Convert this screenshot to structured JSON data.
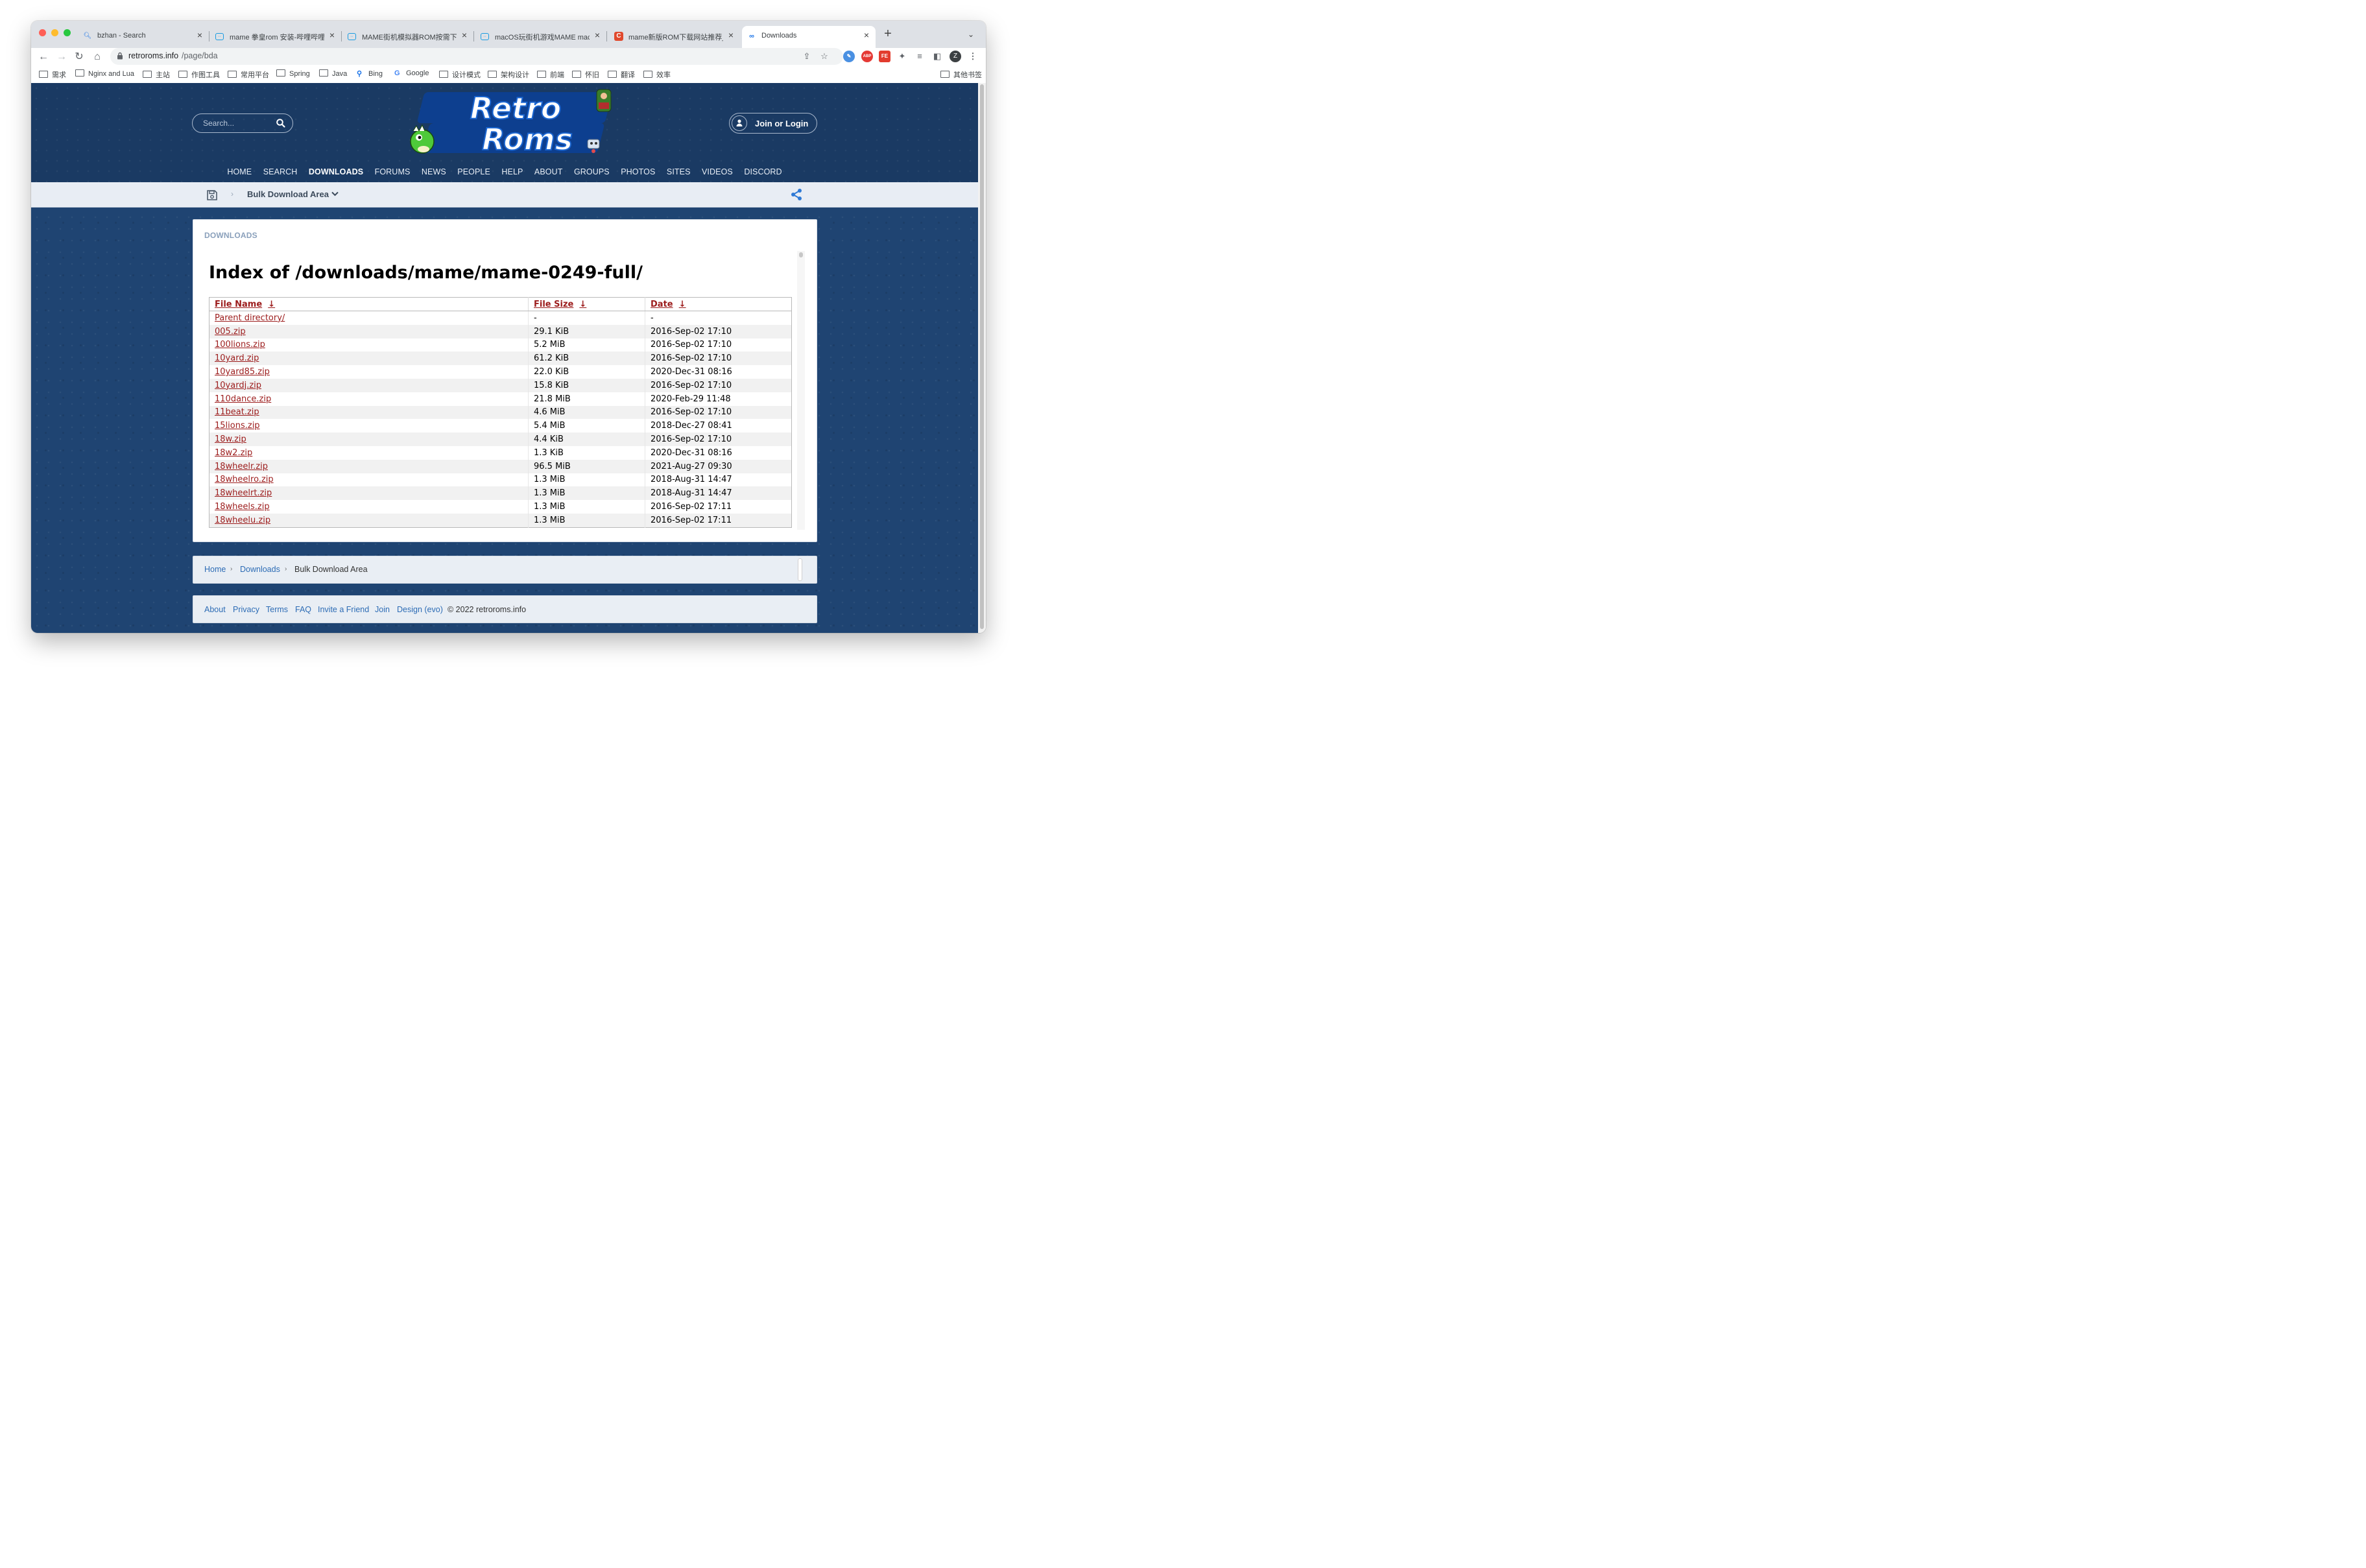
{
  "browser": {
    "tabs": [
      {
        "title": "bzhan - Search",
        "icon": "search-icon"
      },
      {
        "title": "mame 拳皇rom 安装-哔哩哔哩_B",
        "icon": "bilibili-icon"
      },
      {
        "title": "MAME街机模拟器ROM按需下载",
        "icon": "bilibili-icon"
      },
      {
        "title": "macOS玩街机游戏MAME mac版",
        "icon": "bilibili-icon"
      },
      {
        "title": "mame新版ROM下载网站推荐_IT",
        "icon": "csdn-icon"
      },
      {
        "title": "Downloads",
        "icon": "retroroms-icon"
      }
    ],
    "url_host": "retroroms.info",
    "url_path": "/page/bda",
    "profile_initial": "Z",
    "bookmarks": [
      {
        "label": "需求",
        "icon": "folder-icon"
      },
      {
        "label": "Nginx and Lua",
        "icon": "folder-icon"
      },
      {
        "label": "主站",
        "icon": "folder-icon"
      },
      {
        "label": "作图工具",
        "icon": "folder-icon"
      },
      {
        "label": "常用平台",
        "icon": "folder-icon"
      },
      {
        "label": "Spring",
        "icon": "folder-icon"
      },
      {
        "label": "Java",
        "icon": "folder-icon"
      },
      {
        "label": "Bing",
        "icon": "search-icon"
      },
      {
        "label": "Google",
        "icon": "google-icon"
      },
      {
        "label": "设计模式",
        "icon": "folder-icon"
      },
      {
        "label": "架构设计",
        "icon": "folder-icon"
      },
      {
        "label": "前端",
        "icon": "folder-icon"
      },
      {
        "label": "怀旧",
        "icon": "folder-icon"
      },
      {
        "label": "翻译",
        "icon": "folder-icon"
      },
      {
        "label": "效率",
        "icon": "folder-icon"
      }
    ],
    "other_bookmarks": "其他书签"
  },
  "site": {
    "search_placeholder": "Search...",
    "login_label": "Join or Login",
    "logo_line1": "Retro",
    "logo_line2": "Roms",
    "nav": [
      "HOME",
      "SEARCH",
      "DOWNLOADS",
      "FORUMS",
      "NEWS",
      "PEOPLE",
      "HELP",
      "ABOUT",
      "GROUPS",
      "PHOTOS",
      "SITES",
      "VIDEOS",
      "DISCORD"
    ],
    "nav_active": "DOWNLOADS",
    "subbar_title": "Bulk Download Area",
    "panel_label": "DOWNLOADS"
  },
  "listing": {
    "heading": "Index of /downloads/mame/mame-0249-full/",
    "columns": [
      "File Name",
      "File Size",
      "Date"
    ],
    "sort_arrow": "↓",
    "rows": [
      {
        "name": "Parent directory/",
        "size": "-",
        "date": "-"
      },
      {
        "name": "005.zip",
        "size": "29.1 KiB",
        "date": "2016-Sep-02 17:10"
      },
      {
        "name": "100lions.zip",
        "size": "5.2 MiB",
        "date": "2016-Sep-02 17:10"
      },
      {
        "name": "10yard.zip",
        "size": "61.2 KiB",
        "date": "2016-Sep-02 17:10"
      },
      {
        "name": "10yard85.zip",
        "size": "22.0 KiB",
        "date": "2020-Dec-31 08:16"
      },
      {
        "name": "10yardj.zip",
        "size": "15.8 KiB",
        "date": "2016-Sep-02 17:10"
      },
      {
        "name": "110dance.zip",
        "size": "21.8 MiB",
        "date": "2020-Feb-29 11:48"
      },
      {
        "name": "11beat.zip",
        "size": "4.6 MiB",
        "date": "2016-Sep-02 17:10"
      },
      {
        "name": "15lions.zip",
        "size": "5.4 MiB",
        "date": "2018-Dec-27 08:41"
      },
      {
        "name": "18w.zip",
        "size": "4.4 KiB",
        "date": "2016-Sep-02 17:10"
      },
      {
        "name": "18w2.zip",
        "size": "1.3 KiB",
        "date": "2020-Dec-31 08:16"
      },
      {
        "name": "18wheelr.zip",
        "size": "96.5 MiB",
        "date": "2021-Aug-27 09:30"
      },
      {
        "name": "18wheelro.zip",
        "size": "1.3 MiB",
        "date": "2018-Aug-31 14:47"
      },
      {
        "name": "18wheelrt.zip",
        "size": "1.3 MiB",
        "date": "2018-Aug-31 14:47"
      },
      {
        "name": "18wheels.zip",
        "size": "1.3 MiB",
        "date": "2016-Sep-02 17:11"
      },
      {
        "name": "18wheelu.zip",
        "size": "1.3 MiB",
        "date": "2016-Sep-02 17:11"
      }
    ]
  },
  "breadcrumb": {
    "home": "Home",
    "downloads": "Downloads",
    "current": "Bulk Download Area",
    "separator": "›"
  },
  "footer": {
    "links": [
      "About",
      "Privacy",
      "Terms",
      "FAQ",
      "Invite a Friend",
      "Join",
      "Design (evo)"
    ],
    "copyright": "© 2022 retroroms.info"
  },
  "colors": {
    "link_red": "#9c1c1c",
    "site_blue": "#1f4472",
    "footer_link": "#2d6cb5"
  }
}
